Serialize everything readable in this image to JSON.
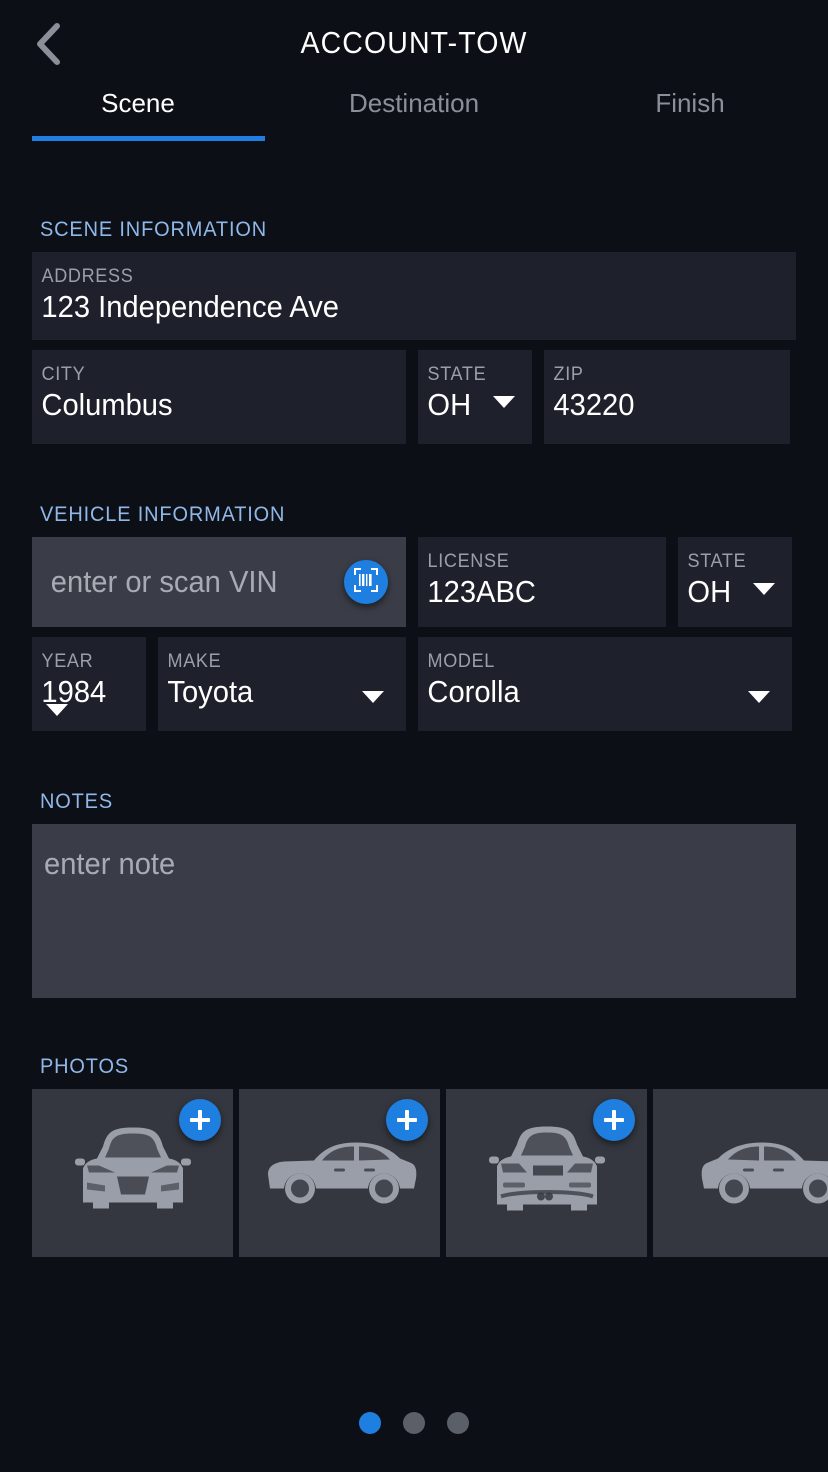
{
  "header": {
    "title": "ACCOUNT-TOW",
    "back_icon": "chevron-left-icon"
  },
  "tabs": [
    {
      "label": "Scene",
      "active": true
    },
    {
      "label": "Destination",
      "active": false
    },
    {
      "label": "Finish",
      "active": false
    }
  ],
  "scene": {
    "section_title": "SCENE INFORMATION",
    "address": {
      "label": "ADDRESS",
      "value": "123 Independence Ave"
    },
    "city": {
      "label": "CITY",
      "value": "Columbus"
    },
    "state": {
      "label": "STATE",
      "value": "OH"
    },
    "zip": {
      "label": "ZIP",
      "value": "43220"
    }
  },
  "vehicle": {
    "section_title": "VEHICLE INFORMATION",
    "vin": {
      "placeholder": "enter or scan VIN",
      "value": "",
      "scan_icon": "barcode-scan-icon"
    },
    "license": {
      "label": "LICENSE",
      "value": "123ABC"
    },
    "state": {
      "label": "STATE",
      "value": "OH"
    },
    "year": {
      "label": "YEAR",
      "value": "1984"
    },
    "make": {
      "label": "MAKE",
      "value": "Toyota"
    },
    "model": {
      "label": "MODEL",
      "value": "Corolla"
    }
  },
  "notes": {
    "section_title": "NOTES",
    "placeholder": "enter note",
    "value": ""
  },
  "photos": {
    "section_title": "PHOTOS",
    "tiles": [
      {
        "icon": "car-front-icon",
        "has_add": true
      },
      {
        "icon": "car-side-left-icon",
        "has_add": true
      },
      {
        "icon": "car-rear-icon",
        "has_add": true
      },
      {
        "icon": "car-side-right-icon",
        "has_add": false
      }
    ]
  },
  "pagination": {
    "count": 3,
    "active_index": 0
  },
  "colors": {
    "page_background": "#0d0f17",
    "field_background": "#1e212b",
    "empty_field_background": "#3a3d47",
    "accent_blue": "#1f7fe0",
    "section_label_blue": "#8fb8e8",
    "photo_tile_background": "#34373f",
    "car_silhouette": "#9a9ea8"
  }
}
